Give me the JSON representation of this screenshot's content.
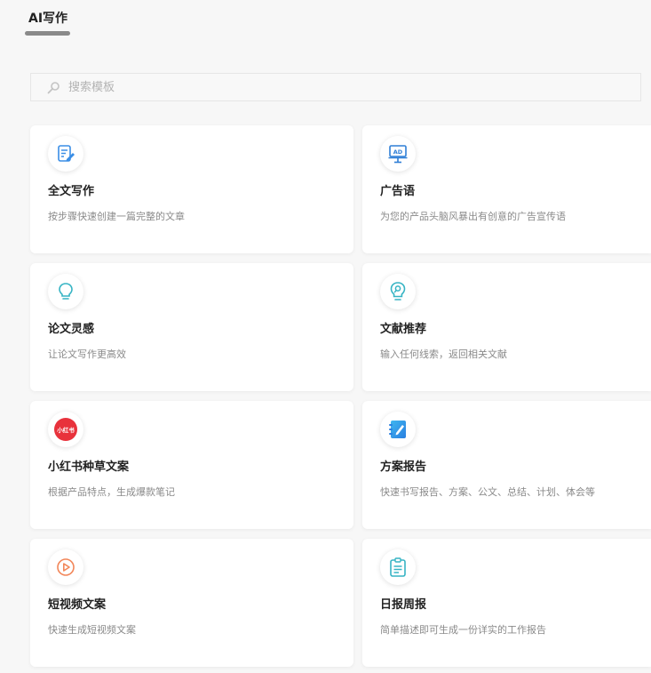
{
  "tab": {
    "label": "AI写作"
  },
  "search": {
    "placeholder": "搜索模板"
  },
  "cards": [
    {
      "title": "全文写作",
      "desc": "按步骤快速创建一篇完整的文章",
      "icon": "document-edit-icon"
    },
    {
      "title": "广告语",
      "desc": "为您的产品头脑风暴出有创意的广告宣传语",
      "icon": "ad-billboard-icon"
    },
    {
      "title": "论文灵感",
      "desc": "让论文写作更高效",
      "icon": "lightbulb-icon"
    },
    {
      "title": "文献推荐",
      "desc": "输入任何线索，返回相关文献",
      "icon": "search-document-icon"
    },
    {
      "title": "小红书种草文案",
      "desc": "根据产品特点，生成爆款笔记",
      "icon": "xiaohongshu-logo-icon",
      "logo_text": "小红书"
    },
    {
      "title": "方案报告",
      "desc": "快速书写报告、方案、公文、总结、计划、体会等",
      "icon": "notebook-pen-icon"
    },
    {
      "title": "短视频文案",
      "desc": "快速生成短视频文案",
      "icon": "play-circle-icon"
    },
    {
      "title": "日报周报",
      "desc": "简单描述即可生成一份详实的工作报告",
      "icon": "clipboard-report-icon"
    }
  ],
  "colors": {
    "accent_blue": "#3a8ee6",
    "teal": "#36b4c4",
    "xiaohongshu_red": "#e8323c",
    "video_orange": "#f2875a"
  }
}
